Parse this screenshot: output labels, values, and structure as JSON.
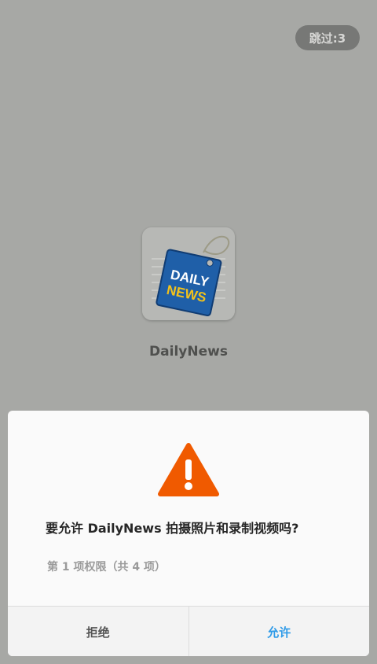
{
  "splash": {
    "skip_label": "跳过:3",
    "app_name": "DailyNews",
    "logo_text_top": "DAILY",
    "logo_text_bottom": "NEWS"
  },
  "permission_dialog": {
    "icon": "warning-icon",
    "question": "要允许 DailyNews 拍摄照片和录制视频吗?",
    "progress": "第 1 项权限（共 4 项）",
    "deny_label": "拒绝",
    "allow_label": "允许"
  },
  "colors": {
    "background_dim": "#a7a8a5",
    "warning": "#f05a00",
    "allow": "#2f9be8",
    "logo_blue": "#1f5fa8",
    "logo_yellow": "#f3c21b"
  }
}
